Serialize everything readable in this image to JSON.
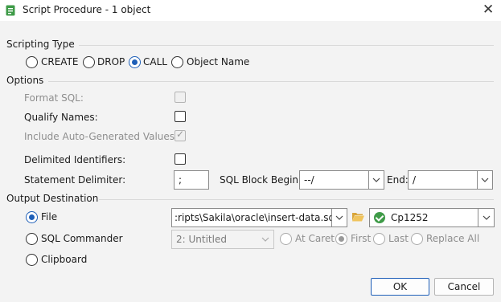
{
  "window": {
    "title": "Script Procedure - 1 object"
  },
  "scripting_type": {
    "label": "Scripting Type",
    "options": [
      "CREATE",
      "DROP",
      "CALL",
      "Object Name"
    ],
    "selected": "CALL"
  },
  "options": {
    "label": "Options",
    "format_sql": "Format SQL:",
    "qualify_names": "Qualify Names:",
    "include_auto": "Include Auto-Generated Values:",
    "delimited_identifiers": "Delimited Identifiers:",
    "statement_delimiter": "Statement Delimiter:",
    "statement_delimiter_value": ";",
    "sql_block_begin": "SQL Block Begin:",
    "sql_block_begin_value": "--/",
    "end": "End:",
    "end_value": "/"
  },
  "output": {
    "label": "Output Destination",
    "file": "File",
    "file_path": ":ripts\\Sakila\\oracle\\insert-data.sql",
    "encoding": "Cp1252",
    "sql_commander": "SQL Commander",
    "commander_value": "2: Untitled",
    "at_caret": "At Caret",
    "first": "First",
    "last": "Last",
    "replace_all": "Replace All",
    "clipboard": "Clipboard",
    "selected": "File"
  },
  "buttons": {
    "ok": "OK",
    "cancel": "Cancel"
  },
  "colors": {
    "accent": "#1e5fb8",
    "valid": "#3f9b48",
    "folder": "#e8b64a"
  }
}
